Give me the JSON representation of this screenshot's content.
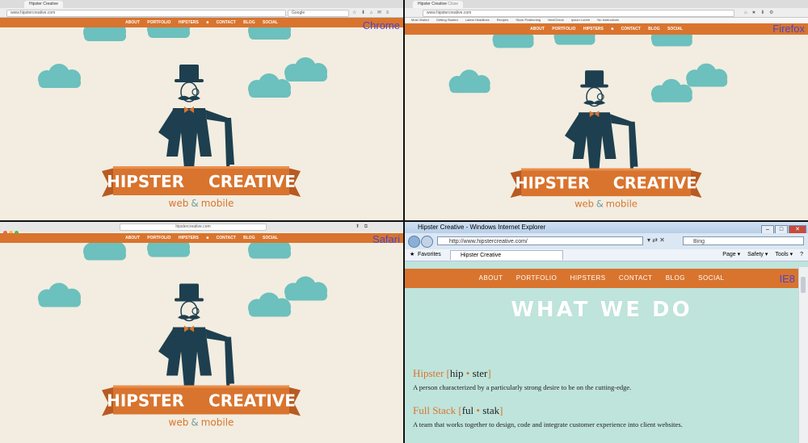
{
  "site_nav": [
    "ABOUT",
    "PORTFOLIO",
    "HIPSTERS",
    "CONTACT",
    "BLOG",
    "SOCIAL"
  ],
  "logo": {
    "left": "HIPSTER",
    "right": "CREATIVE"
  },
  "tagline": {
    "web": "web",
    "amp": "&",
    "mobile": "mobile"
  },
  "chrome": {
    "label": "Chrome",
    "tab": "Hipster Creative",
    "url": "www.hipstercreative.com",
    "search": "Google"
  },
  "firefox": {
    "label": "Firefox",
    "tab": "Hipster Creative",
    "tab_sub": "Close",
    "url": "www.hipstercreative.com",
    "bookmarks": [
      "Most Visited",
      "Getting Started",
      "Latest Headlines"
    ],
    "bookmarks_right": [
      "Recipes",
      "Stock Positioning",
      "NextCheck",
      "Ipsum Lorem",
      "No Instructions"
    ]
  },
  "safari": {
    "label": "Safari",
    "url": "hipstercreative.com"
  },
  "ie": {
    "label": "IE8",
    "window_title": "Hipster Creative - Windows Internet Explorer",
    "url": "http://www.hipstercreative.com/",
    "search_placeholder": "Bing",
    "favorites": "Favorites",
    "tab": "Hipster Creative",
    "commands": [
      "Page ▾",
      "Safety ▾",
      "Tools ▾"
    ],
    "heading": "WHAT WE DO",
    "definitions": [
      {
        "term": "Hipster",
        "phon_left": "hip",
        "phon_right": "ster",
        "text": "A person characterized by a particularly strong desire to be on the cutting-edge."
      },
      {
        "term": "Full Stack",
        "phon_left": "ful",
        "phon_right": "stak",
        "text": "A team that works together to design, code and integrate customer experience into client websites."
      }
    ]
  },
  "colors": {
    "orange": "#d9742e",
    "cream": "#f2ede0",
    "teal": "#6cc0bd",
    "navy": "#1e3f4f",
    "label": "#4b46c8",
    "mint": "#bfe4db"
  }
}
